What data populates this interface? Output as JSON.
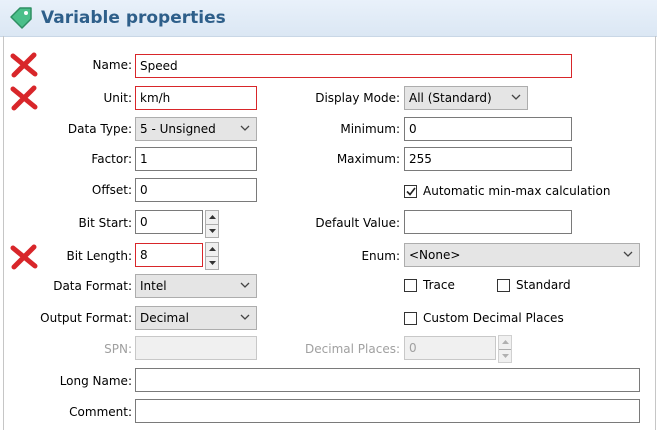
{
  "header": {
    "title": "Variable properties",
    "icon": "tag-icon",
    "color": "#2e5f8a"
  },
  "error_color": "#d8262a",
  "form": {
    "name": {
      "label": "Name:",
      "value": "Speed",
      "error": true
    },
    "unit": {
      "label": "Unit:",
      "value": "km/h",
      "error": true
    },
    "display_mode": {
      "label": "Display Mode:",
      "value": "All (Standard)"
    },
    "data_type": {
      "label": "Data Type:",
      "value": "5 - Unsigned"
    },
    "minimum": {
      "label": "Minimum:",
      "value": "0"
    },
    "factor": {
      "label": "Factor:",
      "value": "1"
    },
    "maximum": {
      "label": "Maximum:",
      "value": "255"
    },
    "offset": {
      "label": "Offset:",
      "value": "0"
    },
    "auto_minmax": {
      "label": "Automatic min-max calculation",
      "checked": true
    },
    "bit_start": {
      "label": "Bit Start:",
      "value": "0"
    },
    "default_value": {
      "label": "Default Value:",
      "value": ""
    },
    "bit_length": {
      "label": "Bit Length:",
      "value": "8",
      "error": true
    },
    "enum": {
      "label": "Enum:",
      "value": "<None>"
    },
    "data_format": {
      "label": "Data Format:",
      "value": "Intel"
    },
    "trace": {
      "label": "Trace",
      "checked": false
    },
    "standard": {
      "label": "Standard",
      "checked": false
    },
    "output_format": {
      "label": "Output Format:",
      "value": "Decimal"
    },
    "custom_decimal": {
      "label": "Custom Decimal Places",
      "checked": false
    },
    "spn": {
      "label": "SPN:",
      "value": "",
      "disabled": true
    },
    "decimal_places": {
      "label": "Decimal Places:",
      "value": "0",
      "disabled": true
    },
    "long_name": {
      "label": "Long Name:",
      "value": ""
    },
    "comment": {
      "label": "Comment:",
      "value": ""
    }
  }
}
